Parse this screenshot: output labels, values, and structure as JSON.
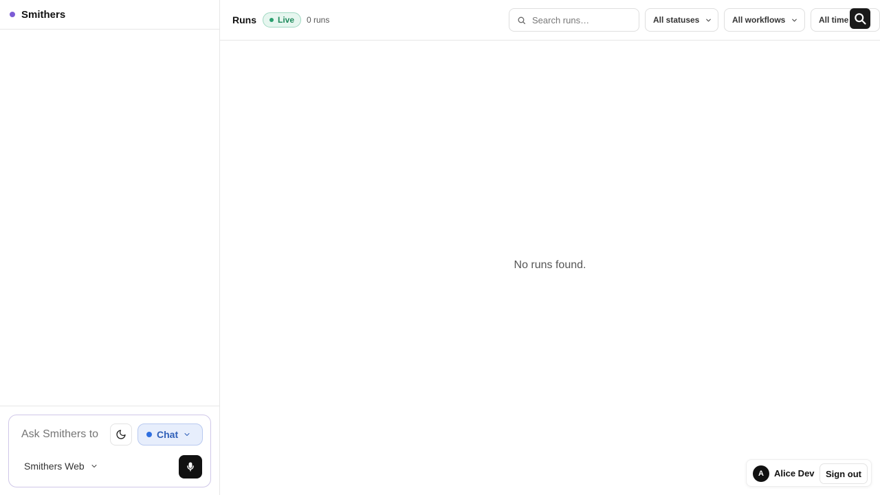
{
  "sidebar": {
    "brand": "Smithers",
    "composer": {
      "placeholder": "Ask Smithers to",
      "mode_label": "Chat",
      "workspace_label": "Smithers Web"
    }
  },
  "header": {
    "title": "Runs",
    "live_badge": "Live",
    "run_count": "0 runs",
    "search_placeholder": "Search runs…",
    "filters": {
      "status": "All statuses",
      "workflow": "All workflows",
      "time": "All time"
    }
  },
  "main": {
    "empty_message": "No runs found."
  },
  "user": {
    "avatar_initial": "A",
    "name": "Alice Dev",
    "signout_label": "Sign out"
  },
  "colors": {
    "brand_dot": "#7c5cd6",
    "live": "#1f8a5c",
    "chat_accent": "#2f5fb8"
  },
  "icons": [
    "search-icon",
    "chevron-down-icon",
    "moon-icon",
    "microphone-icon"
  ]
}
